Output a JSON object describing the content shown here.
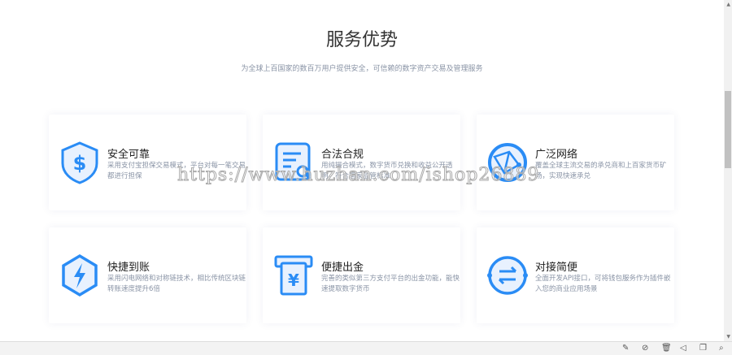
{
  "header": {
    "title": "服务优势",
    "subtitle": "为全球上百国家的数百万用户提供安全，可信赖的数字资产交易及管理服务"
  },
  "cards": [
    {
      "title": "安全可靠",
      "desc": "采用支付宝担保交易模式，平台对每一笔交易都进行担保",
      "icon": "shield-dollar-icon"
    },
    {
      "title": "合法合规",
      "desc": "用纯撮合模式，数字货币兑换和收益公开透明，符合国家监管标准",
      "icon": "document-search-icon"
    },
    {
      "title": "广泛网络",
      "desc": "覆盖全球主流交易的承兑商和上百家货币矿场，实现快速承兑",
      "icon": "globe-network-icon"
    },
    {
      "title": "快捷到账",
      "desc": "采用闪电网络和对称链技术，相比传统区块链转账速度提升6倍",
      "icon": "lightning-icon"
    },
    {
      "title": "便捷出金",
      "desc": "完善的类似第三方支付平台的出金功能，能快速提取数字货币",
      "icon": "yen-withdraw-icon"
    },
    {
      "title": "对接简便",
      "desc": "全面开发API接口，可将钱包服务作为插件嵌入您的商业应用场景",
      "icon": "exchange-arrows-icon"
    }
  ],
  "watermark": "https://www.huzhan.com/ishop26889",
  "colors": {
    "accent": "#2a8cf5",
    "icon_light": "#e8f1fe"
  }
}
